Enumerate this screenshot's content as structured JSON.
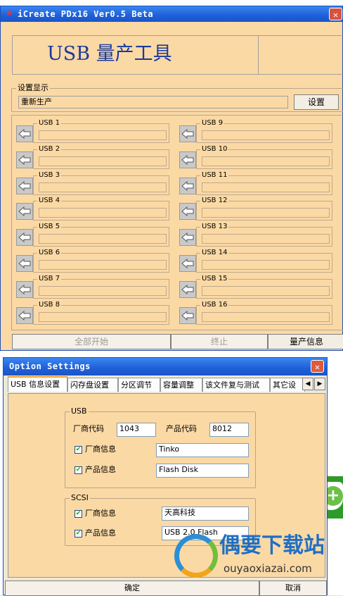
{
  "main_window": {
    "title": "iCreate PDx16 Ver0.5 Beta",
    "close": "✕",
    "banner": "USB 量产工具",
    "settings_group": {
      "title": "设置显示",
      "value": "重新生产",
      "button": "设置"
    },
    "ports_left": [
      "USB 1",
      "USB 2",
      "USB 3",
      "USB 4",
      "USB 5",
      "USB 6",
      "USB 7",
      "USB 8"
    ],
    "ports_right": [
      "USB 9",
      "USB 10",
      "USB 11",
      "USB 12",
      "USB 13",
      "USB 14",
      "USB 15",
      "USB 16"
    ],
    "bottom": {
      "start_all": "全部开始",
      "stop": "终止",
      "info": "量产信息"
    }
  },
  "option_window": {
    "title": "Option Settings",
    "close": "✕",
    "tabs": [
      "USB 信息设置",
      "闪存盘设置",
      "分区调节",
      "容量调整",
      "该文件复与测试",
      "其它设"
    ],
    "tab_scroll_left": "◀",
    "tab_scroll_right": "▶",
    "usb_group": {
      "title": "USB",
      "vendor_code_label": "厂商代码",
      "vendor_code": "1043",
      "product_code_label": "产品代码",
      "product_code": "8012",
      "vendor_info_label": "厂商信息",
      "vendor_info": "Tinko",
      "product_info_label": "产品信息",
      "product_info": "Flash Disk"
    },
    "scsi_group": {
      "title": "SCSI",
      "vendor_info_label": "厂商信息",
      "vendor_info": "天高科技",
      "product_info_label": "产品信息",
      "product_info": "USB 2.0 Flash"
    },
    "ok": "确定",
    "cancel": "取消"
  },
  "watermark": {
    "brand": "偶要下载站",
    "url": "ouyaoxiazai.com"
  },
  "colors": {
    "window_body": "#fbd9a5",
    "titlebar": "#1e5fd8",
    "desktop_green": "#3a9a2a"
  }
}
